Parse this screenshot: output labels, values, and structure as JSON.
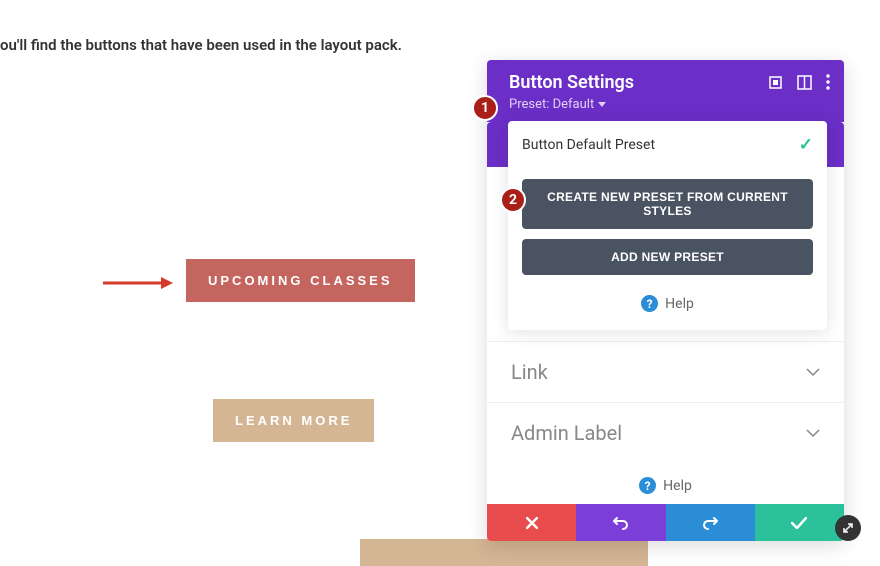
{
  "page": {
    "partial_text": "ou'll find the buttons that have been used in the layout pack."
  },
  "buttons": {
    "upcoming": "UPCOMING CLASSES",
    "learn": "LEARN MORE"
  },
  "panel": {
    "title": "Button Settings",
    "preset_label": "Preset: Default",
    "default_preset": "Button Default Preset",
    "create_preset": "CREATE NEW PRESET FROM CURRENT STYLES",
    "add_preset": "ADD NEW PRESET",
    "help": "Help",
    "sections": {
      "link": "Link",
      "admin": "Admin Label"
    }
  },
  "badges": {
    "b1": "1",
    "b2": "2"
  }
}
